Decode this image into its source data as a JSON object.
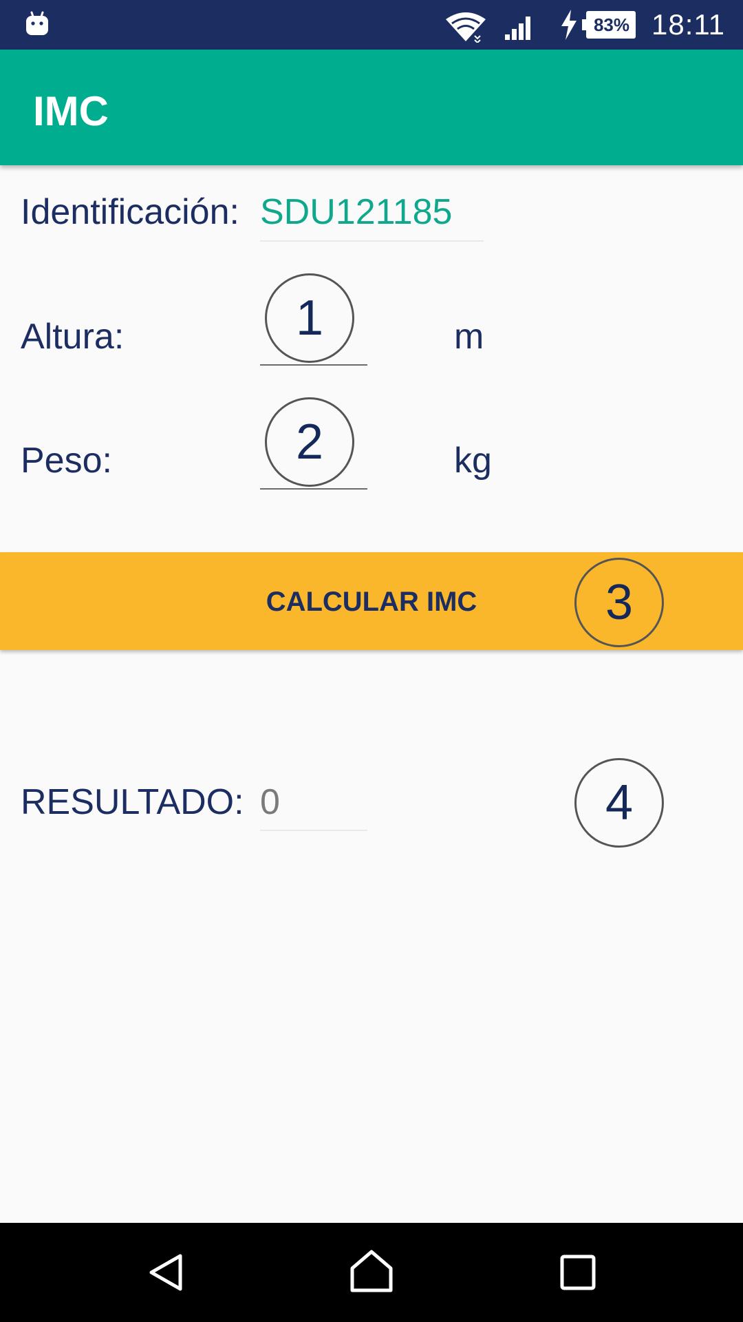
{
  "status_bar": {
    "time": "18:11",
    "battery": "83%",
    "icons": [
      "android-icon",
      "wifi-icon",
      "signal-icon",
      "charging-icon",
      "battery-icon"
    ]
  },
  "app_bar": {
    "title": "IMC"
  },
  "form": {
    "id_label": "Identificación:",
    "id_value": "SDU121185",
    "height_label": "Altura:",
    "height_value": "",
    "height_unit": "m",
    "weight_label": "Peso:",
    "weight_value": "",
    "weight_unit": "kg"
  },
  "calc_button": {
    "label": "CALCULAR IMC"
  },
  "result": {
    "label": "RESULTADO:",
    "value": "0"
  },
  "annotations": [
    "1",
    "2",
    "3",
    "4"
  ],
  "nav_bar": {
    "icons": [
      "back-icon",
      "home-icon",
      "recents-icon"
    ]
  },
  "colors": {
    "status_bar": "#1c2d62",
    "app_bar": "#00ad8f",
    "accent_button": "#fbb72b",
    "text_dark": "#1c2d62",
    "id_value": "#0fa88c"
  }
}
